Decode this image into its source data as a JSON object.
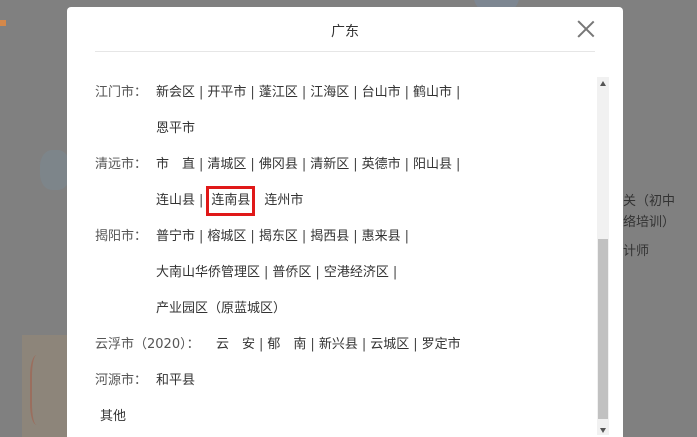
{
  "dialog": {
    "title": "广东",
    "close_icon": "close-icon"
  },
  "separator": "|",
  "regions": [
    {
      "city": "江门市：",
      "lines": [
        [
          {
            "name": "新会区",
            "sep": true
          },
          {
            "name": "开平市",
            "sep": true
          },
          {
            "name": "蓬江区",
            "sep": true
          },
          {
            "name": "江海区",
            "sep": true
          },
          {
            "name": "台山市",
            "sep": true
          },
          {
            "name": "鹤山市",
            "sep": true
          }
        ],
        [
          {
            "name": "恩平市",
            "sep": false
          }
        ]
      ]
    },
    {
      "city": "清远市：",
      "lines": [
        [
          {
            "name": "市　直",
            "sep": true
          },
          {
            "name": "清城区",
            "sep": true
          },
          {
            "name": "佛冈县",
            "sep": true
          },
          {
            "name": "清新区",
            "sep": true
          },
          {
            "name": "英德市",
            "sep": true
          },
          {
            "name": "阳山县",
            "sep": true
          }
        ],
        [
          {
            "name": "连山县",
            "sep": true
          },
          {
            "name": "连南县",
            "sep": false,
            "selected": true
          },
          {
            "name": "连州市",
            "sep": false
          }
        ]
      ]
    },
    {
      "city": "揭阳市：",
      "lines": [
        [
          {
            "name": "普宁市",
            "sep": true
          },
          {
            "name": "榕城区",
            "sep": true
          },
          {
            "name": "揭东区",
            "sep": true
          },
          {
            "name": "揭西县",
            "sep": true
          },
          {
            "name": "惠来县",
            "sep": true
          }
        ],
        [
          {
            "name": "大南山华侨管理区",
            "sep": true
          },
          {
            "name": "普侨区",
            "sep": true
          },
          {
            "name": "空港经济区",
            "sep": true
          }
        ],
        [
          {
            "name": "产业园区（原蓝城区）",
            "sep": false
          }
        ]
      ]
    },
    {
      "city": "云浮市（2020）：",
      "lines": [
        [
          {
            "name": "云　安",
            "sep": true
          },
          {
            "name": "郁　南",
            "sep": true
          },
          {
            "name": "新兴县",
            "sep": true
          },
          {
            "name": "云城区",
            "sep": true
          },
          {
            "name": "罗定市",
            "sep": false
          }
        ]
      ]
    },
    {
      "city": "河源市：",
      "lines": [
        [
          {
            "name": "和平县",
            "sep": false
          }
        ]
      ]
    }
  ],
  "other_label": "其他",
  "background": {
    "right_texts": [
      "关（初中",
      "络培训）",
      "计师"
    ]
  }
}
